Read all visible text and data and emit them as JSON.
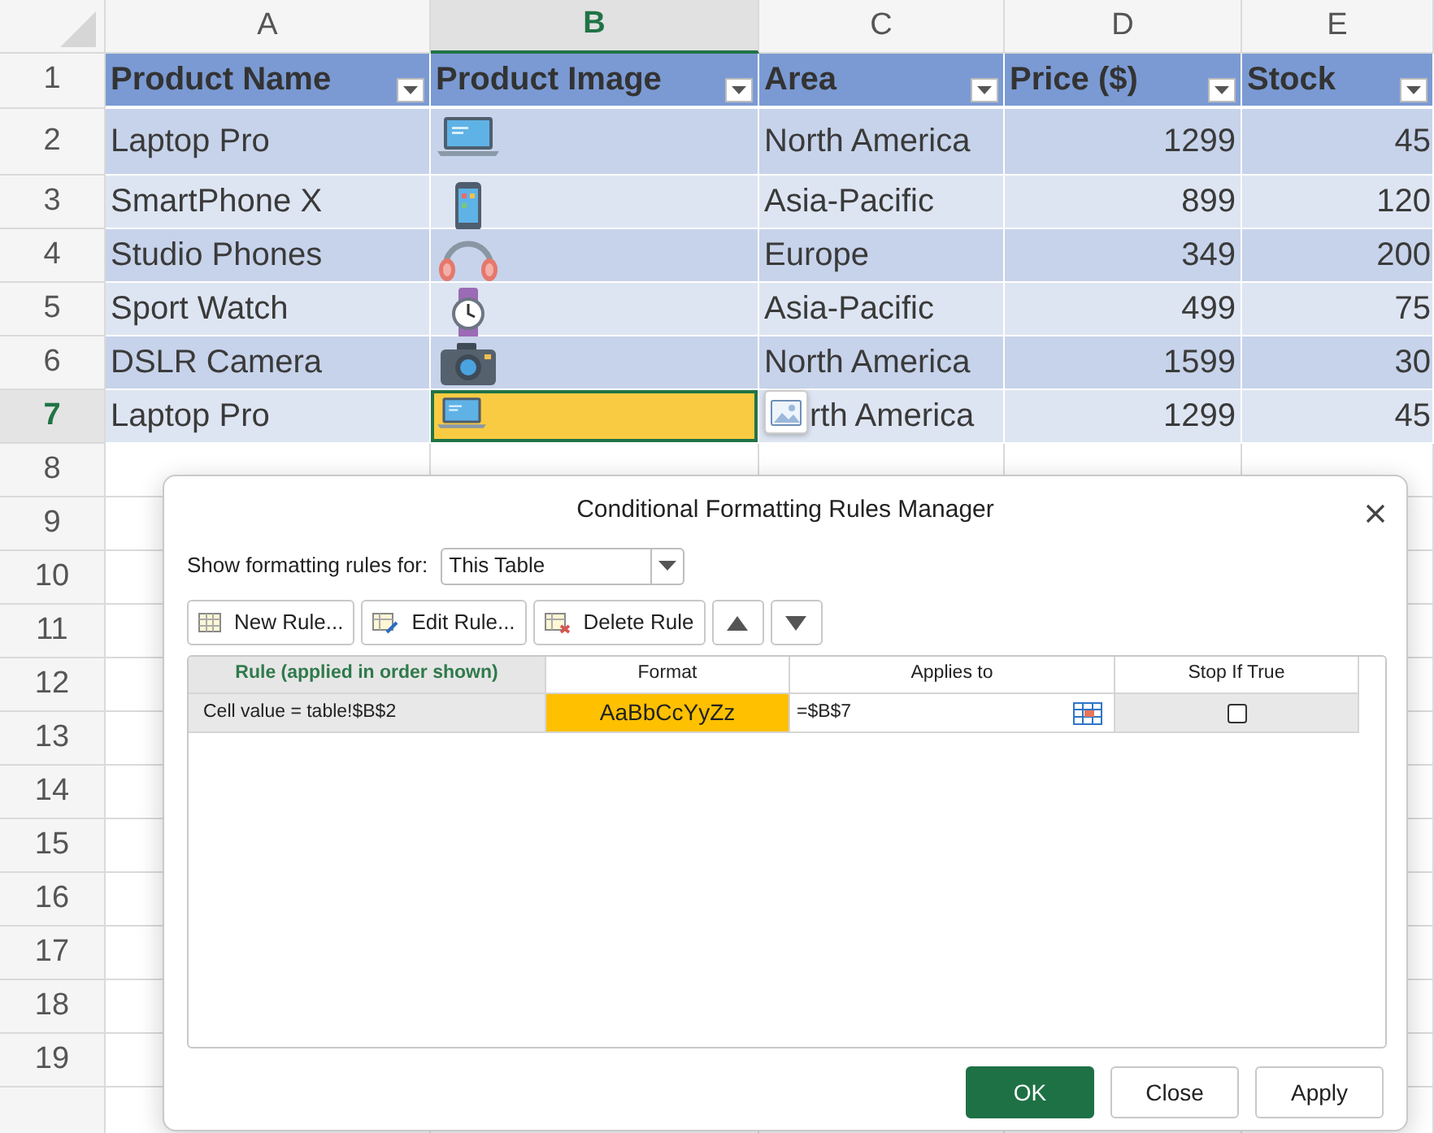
{
  "columns": [
    {
      "label": "A",
      "selected": false
    },
    {
      "label": "B",
      "selected": true
    },
    {
      "label": "C",
      "selected": false
    },
    {
      "label": "D",
      "selected": false
    },
    {
      "label": "E",
      "selected": false
    }
  ],
  "table_header": {
    "row": "1",
    "cells": [
      "Product Name",
      "Product Image",
      "Area",
      "Price ($)",
      "Stock"
    ]
  },
  "rows": [
    {
      "row": "2",
      "name": "Laptop Pro",
      "kind": "laptop",
      "area": "North America",
      "price": "1299",
      "stock": "45",
      "selected": false
    },
    {
      "row": "3",
      "name": "SmartPhone X",
      "kind": "phone",
      "area": "Asia-Pacific",
      "price": "899",
      "stock": "120",
      "selected": false
    },
    {
      "row": "4",
      "name": "Studio Phones",
      "kind": "headphones",
      "area": "Europe",
      "price": "349",
      "stock": "200",
      "selected": false
    },
    {
      "row": "5",
      "name": "Sport Watch",
      "kind": "watch",
      "area": "Asia-Pacific",
      "price": "499",
      "stock": "75",
      "selected": false
    },
    {
      "row": "6",
      "name": "DSLR Camera",
      "kind": "camera",
      "area": "North America",
      "price": "1599",
      "stock": "30",
      "selected": false
    },
    {
      "row": "7",
      "name": "Laptop Pro",
      "kind": "laptop",
      "area": "rth America",
      "price": "1299",
      "stock": "45",
      "selected": true
    }
  ],
  "empty_rows": [
    "8",
    "9",
    "10",
    "11",
    "12",
    "13",
    "14",
    "15",
    "16",
    "17",
    "18",
    "19"
  ],
  "dialog": {
    "title": "Conditional Formatting Rules Manager",
    "show_label": "Show formatting rules for:",
    "show_value": "This Table",
    "toolbar": [
      {
        "kind": "new",
        "label": "New Rule..."
      },
      {
        "kind": "edit",
        "label": "Edit Rule..."
      },
      {
        "kind": "delete",
        "label": "Delete Rule"
      },
      {
        "kind": "up"
      },
      {
        "kind": "down"
      }
    ],
    "rules_columns": [
      "Rule (applied in order shown)",
      "Format",
      "Applies to",
      "Stop If True"
    ],
    "rules": [
      {
        "rule": "Cell value = table!$B$2",
        "format": "AaBbCcYyZz",
        "applies_to": "=$B$7",
        "stop_if_true": false
      }
    ],
    "buttons": [
      {
        "kind": "primary",
        "label": "OK"
      },
      {
        "kind": "secondary",
        "label": "Close"
      },
      {
        "kind": "secondary",
        "label": "Apply"
      }
    ]
  }
}
